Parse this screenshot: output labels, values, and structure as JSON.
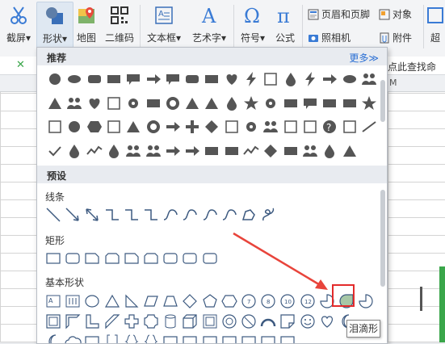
{
  "ribbon": {
    "screenshot": "截屏",
    "shapes": "形状",
    "map": "地图",
    "qrcode": "二维码",
    "textbox": "文本框",
    "wordart": "艺术字",
    "symbol": "符号",
    "formula": "公式",
    "header_footer": "页眉和页脚",
    "object": "对象",
    "camera": "照相机",
    "attachment": "附件",
    "search_hint": "点此查找命令",
    "dropdown_arrow": "▾",
    "overflow": "超"
  },
  "colors": {
    "accent": "#2a6fd4",
    "shape_stroke": "#3d5a80",
    "highlight": "#e32b2b",
    "arrow": "#e8443b"
  },
  "panel": {
    "recommended_title": "推荐",
    "more_label": "更多≫",
    "preset_title": "预设",
    "lines_label": "线条",
    "rects_label": "矩形",
    "basic_label": "基本形状",
    "tooltip": "泪滴形",
    "header_letter": "M"
  }
}
